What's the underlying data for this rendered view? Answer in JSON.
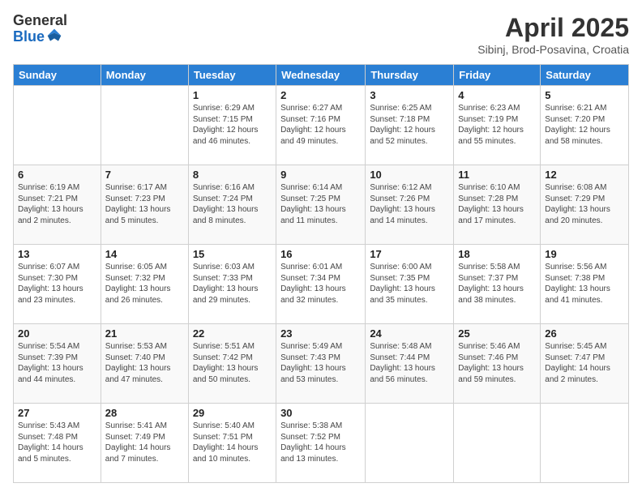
{
  "logo": {
    "general": "General",
    "blue": "Blue"
  },
  "title": {
    "month": "April 2025",
    "location": "Sibinj, Brod-Posavina, Croatia"
  },
  "weekdays": [
    "Sunday",
    "Monday",
    "Tuesday",
    "Wednesday",
    "Thursday",
    "Friday",
    "Saturday"
  ],
  "weeks": [
    [
      {
        "day": "",
        "sunrise": "",
        "sunset": "",
        "daylight": ""
      },
      {
        "day": "",
        "sunrise": "",
        "sunset": "",
        "daylight": ""
      },
      {
        "day": "1",
        "sunrise": "Sunrise: 6:29 AM",
        "sunset": "Sunset: 7:15 PM",
        "daylight": "Daylight: 12 hours and 46 minutes."
      },
      {
        "day": "2",
        "sunrise": "Sunrise: 6:27 AM",
        "sunset": "Sunset: 7:16 PM",
        "daylight": "Daylight: 12 hours and 49 minutes."
      },
      {
        "day": "3",
        "sunrise": "Sunrise: 6:25 AM",
        "sunset": "Sunset: 7:18 PM",
        "daylight": "Daylight: 12 hours and 52 minutes."
      },
      {
        "day": "4",
        "sunrise": "Sunrise: 6:23 AM",
        "sunset": "Sunset: 7:19 PM",
        "daylight": "Daylight: 12 hours and 55 minutes."
      },
      {
        "day": "5",
        "sunrise": "Sunrise: 6:21 AM",
        "sunset": "Sunset: 7:20 PM",
        "daylight": "Daylight: 12 hours and 58 minutes."
      }
    ],
    [
      {
        "day": "6",
        "sunrise": "Sunrise: 6:19 AM",
        "sunset": "Sunset: 7:21 PM",
        "daylight": "Daylight: 13 hours and 2 minutes."
      },
      {
        "day": "7",
        "sunrise": "Sunrise: 6:17 AM",
        "sunset": "Sunset: 7:23 PM",
        "daylight": "Daylight: 13 hours and 5 minutes."
      },
      {
        "day": "8",
        "sunrise": "Sunrise: 6:16 AM",
        "sunset": "Sunset: 7:24 PM",
        "daylight": "Daylight: 13 hours and 8 minutes."
      },
      {
        "day": "9",
        "sunrise": "Sunrise: 6:14 AM",
        "sunset": "Sunset: 7:25 PM",
        "daylight": "Daylight: 13 hours and 11 minutes."
      },
      {
        "day": "10",
        "sunrise": "Sunrise: 6:12 AM",
        "sunset": "Sunset: 7:26 PM",
        "daylight": "Daylight: 13 hours and 14 minutes."
      },
      {
        "day": "11",
        "sunrise": "Sunrise: 6:10 AM",
        "sunset": "Sunset: 7:28 PM",
        "daylight": "Daylight: 13 hours and 17 minutes."
      },
      {
        "day": "12",
        "sunrise": "Sunrise: 6:08 AM",
        "sunset": "Sunset: 7:29 PM",
        "daylight": "Daylight: 13 hours and 20 minutes."
      }
    ],
    [
      {
        "day": "13",
        "sunrise": "Sunrise: 6:07 AM",
        "sunset": "Sunset: 7:30 PM",
        "daylight": "Daylight: 13 hours and 23 minutes."
      },
      {
        "day": "14",
        "sunrise": "Sunrise: 6:05 AM",
        "sunset": "Sunset: 7:32 PM",
        "daylight": "Daylight: 13 hours and 26 minutes."
      },
      {
        "day": "15",
        "sunrise": "Sunrise: 6:03 AM",
        "sunset": "Sunset: 7:33 PM",
        "daylight": "Daylight: 13 hours and 29 minutes."
      },
      {
        "day": "16",
        "sunrise": "Sunrise: 6:01 AM",
        "sunset": "Sunset: 7:34 PM",
        "daylight": "Daylight: 13 hours and 32 minutes."
      },
      {
        "day": "17",
        "sunrise": "Sunrise: 6:00 AM",
        "sunset": "Sunset: 7:35 PM",
        "daylight": "Daylight: 13 hours and 35 minutes."
      },
      {
        "day": "18",
        "sunrise": "Sunrise: 5:58 AM",
        "sunset": "Sunset: 7:37 PM",
        "daylight": "Daylight: 13 hours and 38 minutes."
      },
      {
        "day": "19",
        "sunrise": "Sunrise: 5:56 AM",
        "sunset": "Sunset: 7:38 PM",
        "daylight": "Daylight: 13 hours and 41 minutes."
      }
    ],
    [
      {
        "day": "20",
        "sunrise": "Sunrise: 5:54 AM",
        "sunset": "Sunset: 7:39 PM",
        "daylight": "Daylight: 13 hours and 44 minutes."
      },
      {
        "day": "21",
        "sunrise": "Sunrise: 5:53 AM",
        "sunset": "Sunset: 7:40 PM",
        "daylight": "Daylight: 13 hours and 47 minutes."
      },
      {
        "day": "22",
        "sunrise": "Sunrise: 5:51 AM",
        "sunset": "Sunset: 7:42 PM",
        "daylight": "Daylight: 13 hours and 50 minutes."
      },
      {
        "day": "23",
        "sunrise": "Sunrise: 5:49 AM",
        "sunset": "Sunset: 7:43 PM",
        "daylight": "Daylight: 13 hours and 53 minutes."
      },
      {
        "day": "24",
        "sunrise": "Sunrise: 5:48 AM",
        "sunset": "Sunset: 7:44 PM",
        "daylight": "Daylight: 13 hours and 56 minutes."
      },
      {
        "day": "25",
        "sunrise": "Sunrise: 5:46 AM",
        "sunset": "Sunset: 7:46 PM",
        "daylight": "Daylight: 13 hours and 59 minutes."
      },
      {
        "day": "26",
        "sunrise": "Sunrise: 5:45 AM",
        "sunset": "Sunset: 7:47 PM",
        "daylight": "Daylight: 14 hours and 2 minutes."
      }
    ],
    [
      {
        "day": "27",
        "sunrise": "Sunrise: 5:43 AM",
        "sunset": "Sunset: 7:48 PM",
        "daylight": "Daylight: 14 hours and 5 minutes."
      },
      {
        "day": "28",
        "sunrise": "Sunrise: 5:41 AM",
        "sunset": "Sunset: 7:49 PM",
        "daylight": "Daylight: 14 hours and 7 minutes."
      },
      {
        "day": "29",
        "sunrise": "Sunrise: 5:40 AM",
        "sunset": "Sunset: 7:51 PM",
        "daylight": "Daylight: 14 hours and 10 minutes."
      },
      {
        "day": "30",
        "sunrise": "Sunrise: 5:38 AM",
        "sunset": "Sunset: 7:52 PM",
        "daylight": "Daylight: 14 hours and 13 minutes."
      },
      {
        "day": "",
        "sunrise": "",
        "sunset": "",
        "daylight": ""
      },
      {
        "day": "",
        "sunrise": "",
        "sunset": "",
        "daylight": ""
      },
      {
        "day": "",
        "sunrise": "",
        "sunset": "",
        "daylight": ""
      }
    ]
  ]
}
